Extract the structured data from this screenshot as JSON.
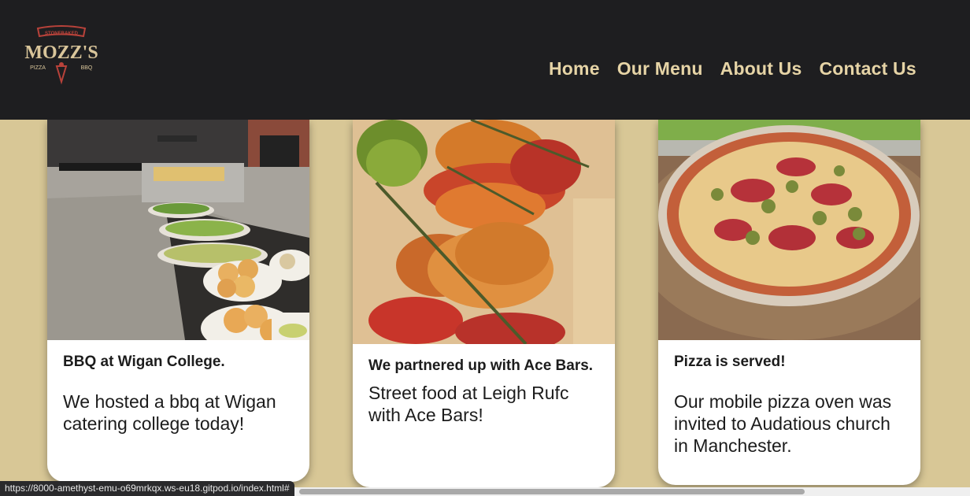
{
  "header": {
    "logo": {
      "top": "STONEBAKED",
      "name": "MOZZ'S",
      "left": "PIZZA",
      "right": "BBQ"
    },
    "nav": [
      "Home",
      "Our Menu",
      "About Us",
      "Contact Us"
    ]
  },
  "cards": [
    {
      "title": "BBQ at Wigan College.",
      "text": "We hosted a bbq at Wigan catering college today!",
      "photo": "bbq-buffet-photo"
    },
    {
      "title": "We partnered up with Ace Bars.",
      "text": "Street food at Leigh Rufc with Ace Bars!",
      "photo": "chicken-skewer-photo"
    },
    {
      "title": "Pizza is served!",
      "text": "Our mobile pizza oven was invited to Audatious church in Manchester.",
      "photo": "pizza-photo"
    }
  ],
  "status_url": "https://8000-amethyst-emu-o69mrkqx.ws-eu18.gitpod.io/index.html#",
  "colors": {
    "header": "#1e1e20",
    "nav": "#e6d4a6",
    "background": "#d8c796",
    "logo": "#c9473a"
  }
}
